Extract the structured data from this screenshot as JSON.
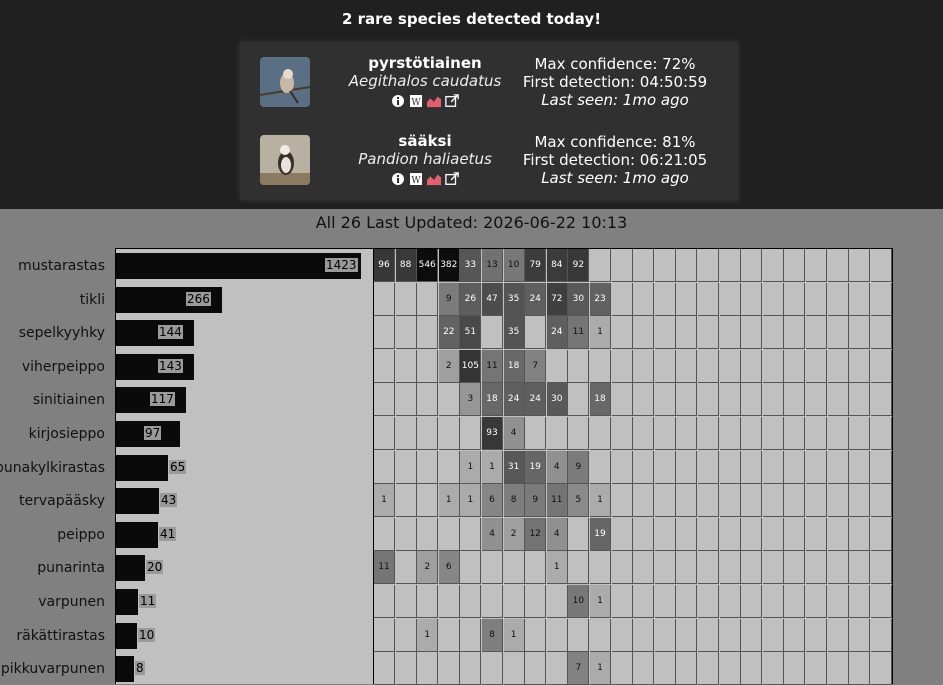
{
  "header": {
    "title": "2 rare species detected today!"
  },
  "rare": [
    {
      "common": "pyrstötiainen",
      "sci": "Aegithalos caudatus",
      "max_conf": "Max confidence: 72%",
      "first": "First detection: 04:50:59",
      "last": "Last seen: 1mo ago"
    },
    {
      "common": "sääksi",
      "sci": "Pandion haliaetus",
      "max_conf": "Max confidence: 81%",
      "first": "First detection: 06:21:05",
      "last": "Last seen: 1mo ago"
    }
  ],
  "updated": "All 26 Last Updated: 2026-06-22 10:13",
  "species": [
    {
      "name": "mustarastas",
      "total": "1423",
      "hours": [
        "96",
        "88",
        "546",
        "382",
        "33",
        "13",
        "10",
        "79",
        "84",
        "92",
        "",
        "",
        "",
        "",
        "",
        "",
        "",
        "",
        "",
        "",
        "",
        "",
        "",
        ""
      ]
    },
    {
      "name": "tikli",
      "total": "266",
      "hours": [
        "",
        "",
        "",
        "9",
        "26",
        "47",
        "35",
        "24",
        "72",
        "30",
        "23",
        "",
        "",
        "",
        "",
        "",
        "",
        "",
        "",
        "",
        "",
        "",
        "",
        ""
      ]
    },
    {
      "name": "sepelkyyhky",
      "total": "144",
      "hours": [
        "",
        "",
        "",
        "22",
        "51",
        "",
        "35",
        "",
        "24",
        "11",
        "1",
        "",
        "",
        "",
        "",
        "",
        "",
        "",
        "",
        "",
        "",
        "",
        "",
        ""
      ]
    },
    {
      "name": "viherpeippo",
      "total": "143",
      "hours": [
        "",
        "",
        "",
        "2",
        "105",
        "11",
        "18",
        "7",
        "",
        "",
        "",
        "",
        "",
        "",
        "",
        "",
        "",
        "",
        "",
        "",
        "",
        "",
        "",
        ""
      ]
    },
    {
      "name": "sinitiainen",
      "total": "117",
      "hours": [
        "",
        "",
        "",
        "",
        "3",
        "18",
        "24",
        "24",
        "30",
        "",
        "18",
        "",
        "",
        "",
        "",
        "",
        "",
        "",
        "",
        "",
        "",
        "",
        "",
        ""
      ]
    },
    {
      "name": "kirjosieppo",
      "total": "97",
      "hours": [
        "",
        "",
        "",
        "",
        "",
        "93",
        "4",
        "",
        "",
        "",
        "",
        "",
        "",
        "",
        "",
        "",
        "",
        "",
        "",
        "",
        "",
        "",
        "",
        ""
      ]
    },
    {
      "name": "punakylkirastas",
      "total": "65",
      "hours": [
        "",
        "",
        "",
        "",
        "1",
        "1",
        "31",
        "19",
        "4",
        "9",
        "",
        "",
        "",
        "",
        "",
        "",
        "",
        "",
        "",
        "",
        "",
        "",
        "",
        ""
      ]
    },
    {
      "name": "tervapääsky",
      "total": "43",
      "hours": [
        "1",
        "",
        "",
        "1",
        "1",
        "6",
        "8",
        "9",
        "11",
        "5",
        "1",
        "",
        "",
        "",
        "",
        "",
        "",
        "",
        "",
        "",
        "",
        "",
        "",
        ""
      ]
    },
    {
      "name": "peippo",
      "total": "41",
      "hours": [
        "",
        "",
        "",
        "",
        "",
        "4",
        "2",
        "12",
        "4",
        "",
        "19",
        "",
        "",
        "",
        "",
        "",
        "",
        "",
        "",
        "",
        "",
        "",
        "",
        ""
      ]
    },
    {
      "name": "punarinta",
      "total": "20",
      "hours": [
        "11",
        "",
        "2",
        "6",
        "",
        "",
        "",
        "",
        "1",
        "",
        "",
        "",
        "",
        "",
        "",
        "",
        "",
        "",
        "",
        "",
        "",
        "",
        "",
        ""
      ]
    },
    {
      "name": "varpunen",
      "total": "11",
      "hours": [
        "",
        "",
        "",
        "",
        "",
        "",
        "",
        "",
        "",
        "10",
        "1",
        "",
        "",
        "",
        "",
        "",
        "",
        "",
        "",
        "",
        "",
        "",
        "",
        ""
      ]
    },
    {
      "name": "räkättirastas",
      "total": "10",
      "hours": [
        "",
        "",
        "1",
        "",
        "",
        "8",
        "1",
        "",
        "",
        "",
        "",
        "",
        "",
        "",
        "",
        "",
        "",
        "",
        "",
        "",
        "",
        "",
        "",
        ""
      ]
    },
    {
      "name": "pikkuvarpunen",
      "total": "8",
      "hours": [
        "",
        "",
        "",
        "",
        "",
        "",
        "",
        "",
        "",
        "7",
        "1",
        "",
        "",
        "",
        "",
        "",
        "",
        "",
        "",
        "",
        "",
        "",
        "",
        ""
      ]
    }
  ],
  "colors": {
    "bar": "#0a0a0a",
    "cell_bg": "#c0c0c0",
    "dark": "#0a0a0a"
  }
}
